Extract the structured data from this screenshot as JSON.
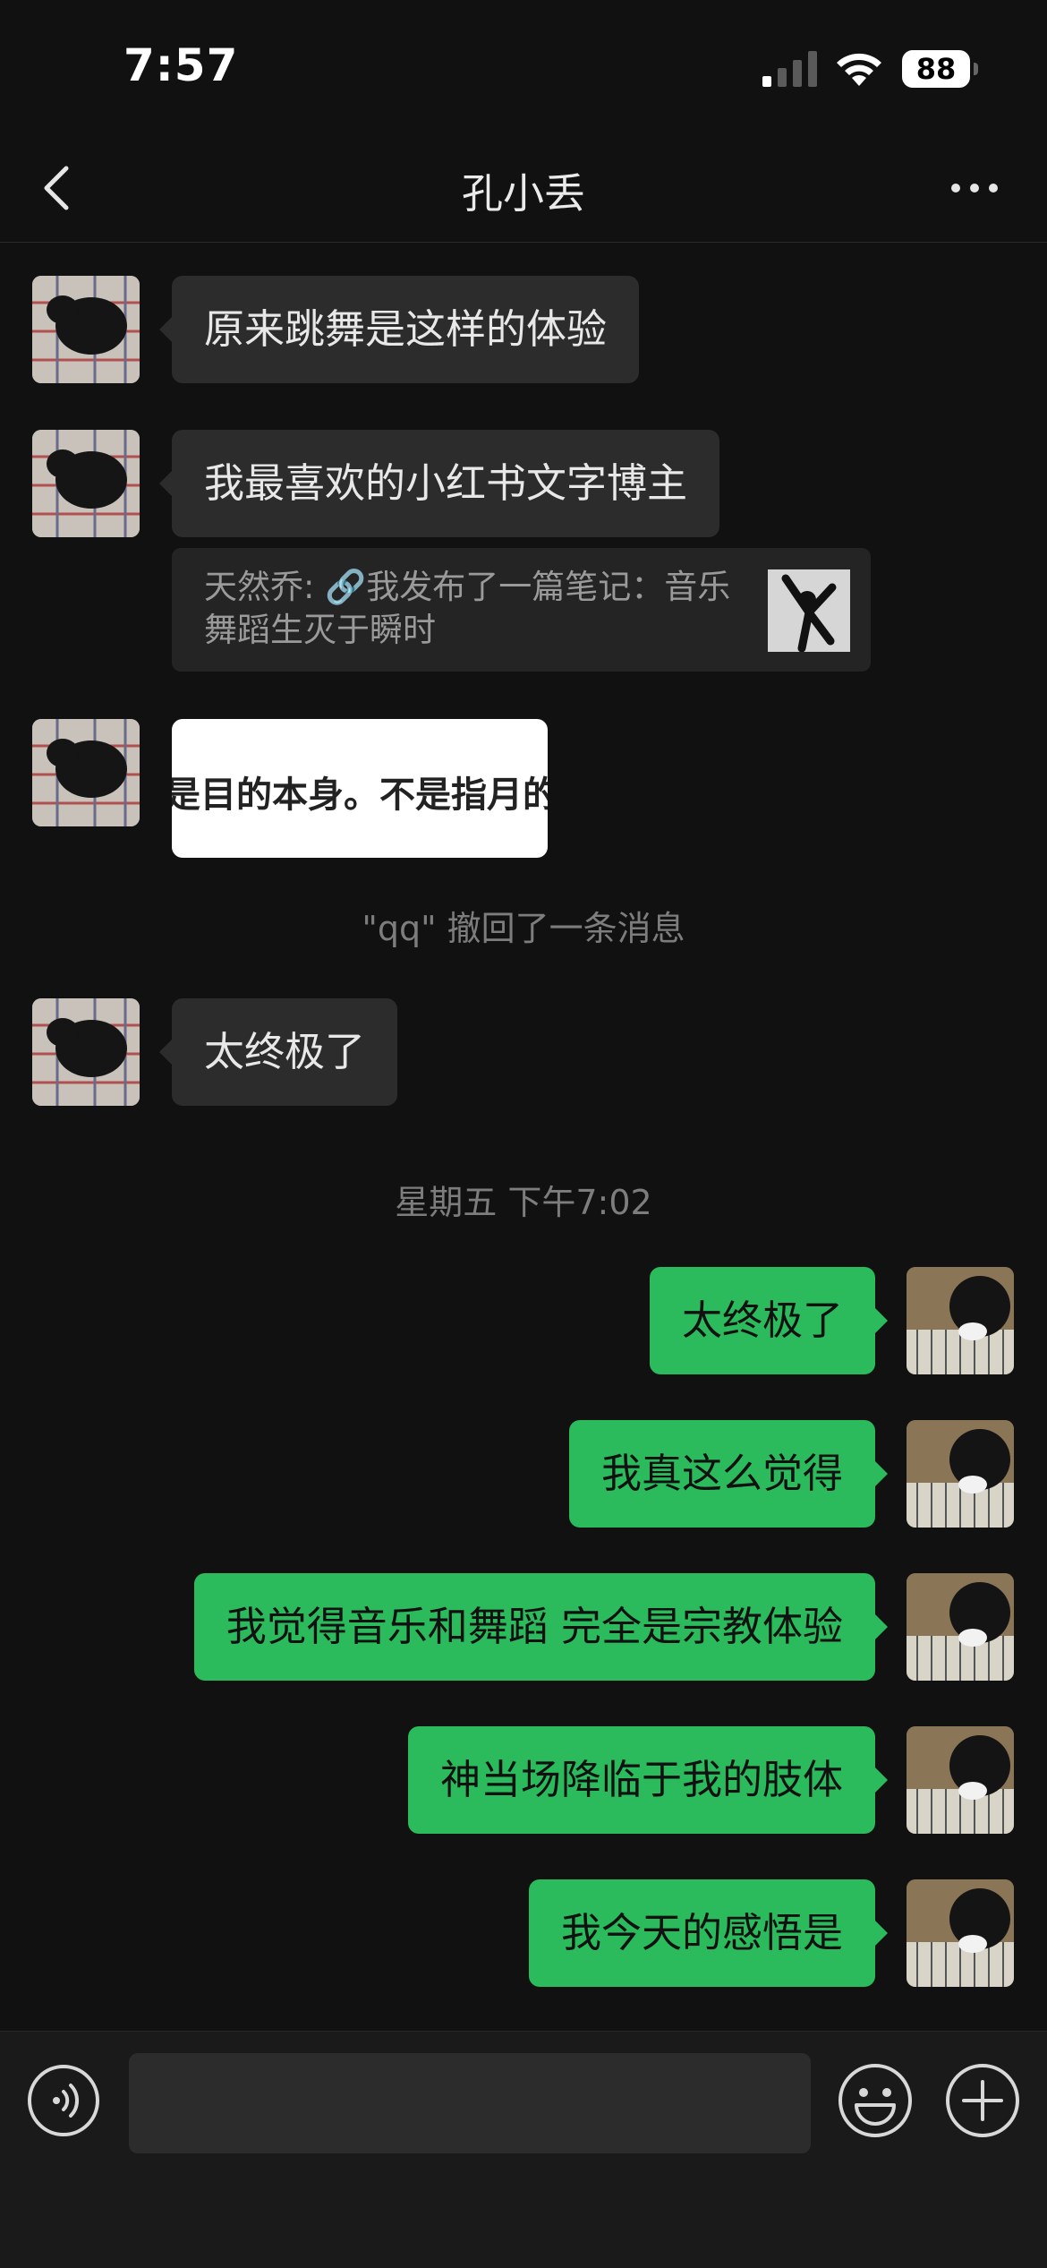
{
  "status_bar": {
    "time": "7:57",
    "battery": "88"
  },
  "nav": {
    "title": "孔小丢"
  },
  "messages": {
    "m1": "原来跳舞是这样的体验",
    "m2": "我最喜欢的小红书文字博主",
    "quote": "天然乔: 🔗我发布了一篇笔记：音乐\n舞蹈生灭于瞬时",
    "image_text": "是目的本身。不是指月的",
    "recall_notice": "\"qq\" 撤回了一条消息",
    "m3": "太终极了",
    "timestamp": "星期五 下午7:02",
    "o1": "太终极了",
    "o2": "我真这么觉得",
    "o3": "我觉得音乐和舞蹈 完全是宗教体验",
    "o4": "神当场降临于我的肢体",
    "o5": "我今天的感悟是"
  },
  "input": {
    "placeholder": ""
  },
  "colors": {
    "background": "#111111",
    "incoming_bubble": "#2c2c2c",
    "outgoing_bubble": "#2bba5c"
  }
}
